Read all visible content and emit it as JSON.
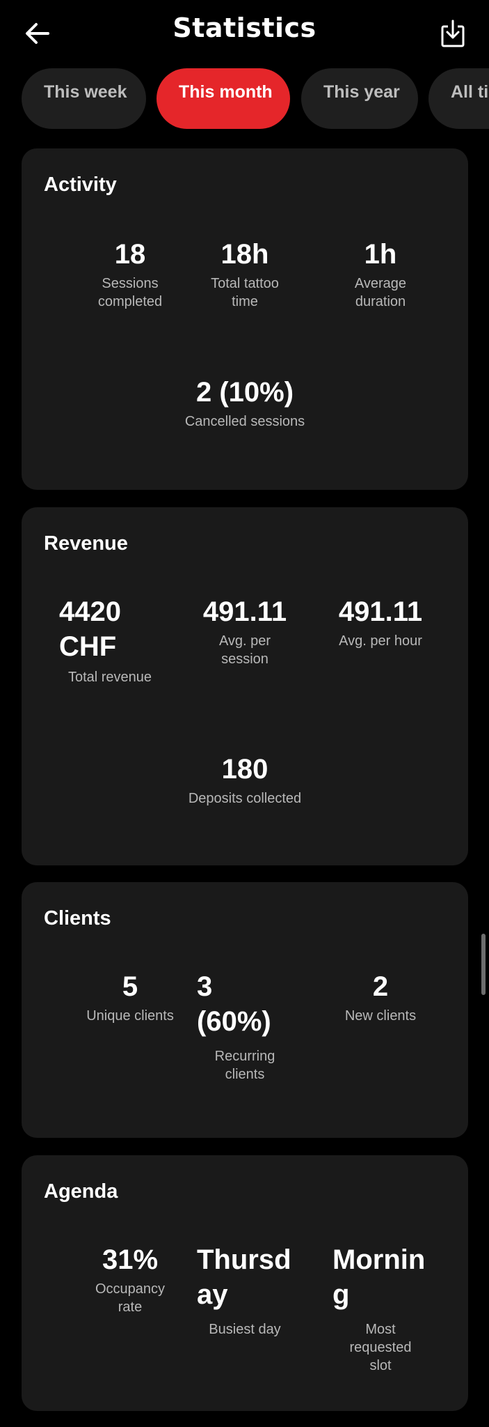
{
  "header": {
    "title": "Statistics",
    "back_icon": "arrow-left-icon",
    "export_icon": "download-icon"
  },
  "tabs": [
    {
      "label": "This week",
      "active": false
    },
    {
      "label": "This month",
      "active": true
    },
    {
      "label": "This year",
      "active": false
    },
    {
      "label": "All time",
      "active": false
    }
  ],
  "colors": {
    "accent": "#e5262a",
    "card": "#1a1a1a",
    "background": "#000000"
  },
  "activity": {
    "title": "Activity",
    "sessions_completed": {
      "value": "18",
      "label": "Sessions completed"
    },
    "total_time": {
      "value": "18h",
      "label": "Total tattoo time"
    },
    "avg_duration": {
      "value": "1h",
      "label": "Average duration"
    },
    "cancelled": {
      "value": "2 (10%)",
      "label": "Cancelled sessions"
    }
  },
  "revenue": {
    "title": "Revenue",
    "total": {
      "value": "4420 CHF",
      "label": "Total revenue"
    },
    "avg_session": {
      "value": "491.11",
      "label": "Avg. per session"
    },
    "avg_hour": {
      "value": "491.11",
      "label": "Avg. per hour"
    },
    "deposits": {
      "value": "180",
      "label": "Deposits collected"
    }
  },
  "clients": {
    "title": "Clients",
    "unique": {
      "value": "5",
      "label": "Unique clients"
    },
    "recurring": {
      "value": "3 (60%)",
      "label": "Recurring clients"
    },
    "new": {
      "value": "2",
      "label": "New clients"
    }
  },
  "agenda": {
    "title": "Agenda",
    "occupancy": {
      "value": "31%",
      "label": "Occupancy rate"
    },
    "busiest_day": {
      "value": "Thursday",
      "label": "Busiest day"
    },
    "requested_slot": {
      "value": "Morning",
      "label": "Most requested slot"
    }
  }
}
